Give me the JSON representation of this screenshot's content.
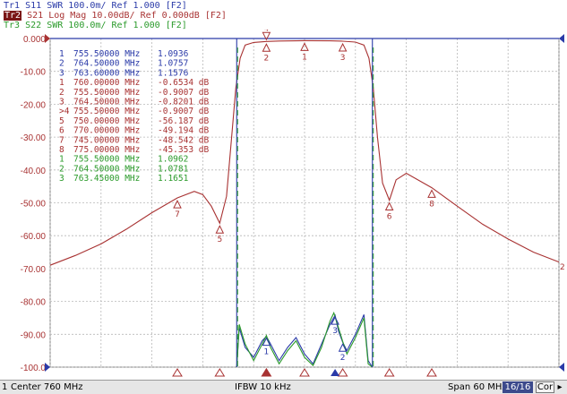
{
  "traces": [
    {
      "id": "Tr1",
      "param": "S11",
      "format": "SWR",
      "scale": "100.0m/",
      "ref": "Ref 1.000",
      "flag": "[F2]",
      "color": "#2a3aa8",
      "active": false
    },
    {
      "id": "Tr2",
      "param": "S21",
      "format": "Log Mag",
      "scale": "10.00dB/",
      "ref": "Ref 0.000dB",
      "flag": "[F2]",
      "color": "#a83232",
      "active": true
    },
    {
      "id": "Tr3",
      "param": "S22",
      "format": "SWR",
      "scale": "100.0m/",
      "ref": "Ref 1.000",
      "flag": "[F2]",
      "color": "#2a9a2a",
      "active": false
    }
  ],
  "y_axis_labels": [
    "0.000",
    "-10.00",
    "-20.00",
    "-30.00",
    "-40.00",
    "-50.00",
    "-60.00",
    "-70.00",
    "-80.00",
    "-90.00",
    "-100.0"
  ],
  "marker_table": [
    {
      "no": "1",
      "freq": "755.50000 MHz",
      "value": "1.0936",
      "color": "#2a3aa8"
    },
    {
      "no": "2",
      "freq": "764.50000 MHz",
      "value": "1.0757",
      "color": "#2a3aa8"
    },
    {
      "no": "3",
      "freq": "763.60000 MHz",
      "value": "1.1576",
      "color": "#2a3aa8"
    },
    {
      "no": "1",
      "freq": "760.00000 MHz",
      "value": "-0.6534 dB",
      "color": "#a83232"
    },
    {
      "no": "2",
      "freq": "755.50000 MHz",
      "value": "-0.9007 dB",
      "color": "#a83232"
    },
    {
      "no": "3",
      "freq": "764.50000 MHz",
      "value": "-0.8201 dB",
      "color": "#a83232"
    },
    {
      "no": ">4",
      "freq": "755.50000 MHz",
      "value": "-0.9007 dB",
      "color": "#a83232"
    },
    {
      "no": "5",
      "freq": "750.00000 MHz",
      "value": "-56.187 dB",
      "color": "#a83232"
    },
    {
      "no": "6",
      "freq": "770.00000 MHz",
      "value": "-49.194 dB",
      "color": "#a83232"
    },
    {
      "no": "7",
      "freq": "745.00000 MHz",
      "value": "-48.542 dB",
      "color": "#a83232"
    },
    {
      "no": "8",
      "freq": "775.00000 MHz",
      "value": "-45.353 dB",
      "color": "#a83232"
    },
    {
      "no": "1",
      "freq": "755.50000 MHz",
      "value": "1.0962",
      "color": "#2a9a2a"
    },
    {
      "no": "2",
      "freq": "764.50000 MHz",
      "value": "1.0781",
      "color": "#2a9a2a"
    },
    {
      "no": "3",
      "freq": "763.45000 MHz",
      "value": "1.1651",
      "color": "#2a9a2a"
    }
  ],
  "right_edge_label": "2",
  "status": {
    "channel": "1",
    "center": "Center 760 MHz",
    "ifbw": "IFBW 10 kHz",
    "span": "Span 60 MHz",
    "sweep": "16/16",
    "cor": "Cor",
    "arrow": "▸"
  },
  "chart_data": {
    "type": "line",
    "x_unit": "MHz",
    "xlim": [
      730,
      790
    ],
    "ylim": [
      -100,
      0
    ],
    "y_divisions": 10,
    "grid": true,
    "series": [
      {
        "name": "S21",
        "color": "#a83232",
        "x": [
          730,
          733,
          736,
          739,
          742,
          745,
          747,
          748,
          749,
          750,
          750.8,
          751.4,
          751.9,
          752.4,
          753,
          754,
          755.5,
          757,
          760,
          763,
          764.5,
          766,
          767,
          767.6,
          768.1,
          768.6,
          769.2,
          770,
          770.8,
          772,
          775,
          778,
          781,
          784,
          787,
          790
        ],
        "y": [
          -69,
          -66,
          -62.5,
          -58,
          -53,
          -48.5,
          -46.5,
          -47.5,
          -51,
          -56.2,
          -48,
          -30,
          -15,
          -6,
          -2,
          -1.2,
          -0.9,
          -0.75,
          -0.65,
          -0.7,
          -0.82,
          -1.1,
          -2,
          -6,
          -15,
          -30,
          -44,
          -49.2,
          -43,
          -41,
          -45.4,
          -51,
          -56.5,
          -61,
          -65,
          -68
        ]
      },
      {
        "name": "S11",
        "color": "#2a3aa8",
        "x": [
          752,
          752.3,
          753,
          754,
          755,
          755.5,
          756,
          757,
          758,
          759,
          760,
          761,
          762,
          763,
          763.6,
          764,
          764.5,
          765,
          766,
          767,
          767.5,
          768
        ],
        "y": [
          1.0,
          1.12,
          1.06,
          1.03,
          1.08,
          1.0936,
          1.07,
          1.02,
          1.06,
          1.09,
          1.04,
          1.01,
          1.07,
          1.13,
          1.1576,
          1.11,
          1.0757,
          1.05,
          1.1,
          1.16,
          1.02,
          1.0
        ]
      },
      {
        "name": "S22",
        "color": "#2a9a2a",
        "x": [
          752,
          752.3,
          753,
          754,
          755,
          755.5,
          756,
          757,
          758,
          759,
          760,
          761,
          762,
          763,
          763.45,
          764,
          764.5,
          765,
          766,
          767,
          767.5,
          768
        ],
        "y": [
          1.0,
          1.13,
          1.07,
          1.02,
          1.07,
          1.0962,
          1.06,
          1.01,
          1.05,
          1.08,
          1.03,
          1.005,
          1.06,
          1.14,
          1.1651,
          1.12,
          1.0781,
          1.04,
          1.09,
          1.15,
          1.01,
          1.0
        ]
      }
    ],
    "s21_markers": [
      {
        "label": "1",
        "x": 760.0,
        "y": -0.65
      },
      {
        "label": "2",
        "x": 755.5,
        "y": -0.9
      },
      {
        "label": "3",
        "x": 764.5,
        "y": -0.82
      },
      {
        "label": "4",
        "x": 755.5,
        "y": -0.9
      },
      {
        "label": "5",
        "x": 750.0,
        "y": -56.19
      },
      {
        "label": "6",
        "x": 770.0,
        "y": -49.19
      },
      {
        "label": "7",
        "x": 745.0,
        "y": -48.54
      },
      {
        "label": "8",
        "x": 775.0,
        "y": -45.35
      }
    ],
    "swr_markers": [
      {
        "label": "1",
        "x": 755.5,
        "y": 1.0936,
        "color": "#2a3aa8"
      },
      {
        "label": "2",
        "x": 764.5,
        "y": 1.0757,
        "color": "#2a3aa8"
      },
      {
        "label": "3",
        "x": 763.6,
        "y": 1.1576,
        "color": "#2a3aa8"
      }
    ]
  }
}
